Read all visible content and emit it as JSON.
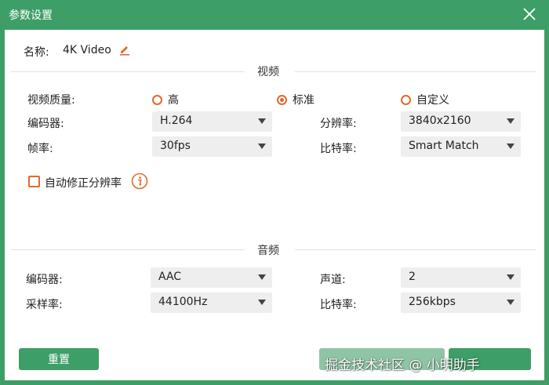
{
  "window": {
    "title": "参数设置"
  },
  "name_row": {
    "label": "名称:",
    "value": "4K Video"
  },
  "video": {
    "section_title": "视频",
    "quality_label": "视频质量:",
    "quality_options": [
      "高",
      "标准",
      "自定义"
    ],
    "quality_selected": "标准",
    "encoder_label": "编码器:",
    "encoder_value": "H.264",
    "resolution_label": "分辨率:",
    "resolution_value": "3840x2160",
    "framerate_label": "帧率:",
    "framerate_value": "30fps",
    "bitrate_label": "比特率:",
    "bitrate_value": "Smart Match",
    "auto_fix_label": "自动修正分辨率",
    "auto_fix_checked": false
  },
  "audio": {
    "section_title": "音频",
    "encoder_label": "编码器:",
    "encoder_value": "AAC",
    "channel_label": "声道:",
    "channel_value": "2",
    "samplerate_label": "采样率:",
    "samplerate_value": "44100Hz",
    "bitrate_label": "比特率:",
    "bitrate_value": "256kbps"
  },
  "footer": {
    "reset_label": "重置"
  },
  "watermark": "掘金技术社区 @ 小明助手",
  "colors": {
    "brand_green": "#3e9e67",
    "accent_orange": "#e2692b"
  },
  "icons": {
    "close": "close-icon",
    "edit": "pencil-icon",
    "info": "info-icon",
    "dropdown": "chevron-down-icon"
  }
}
